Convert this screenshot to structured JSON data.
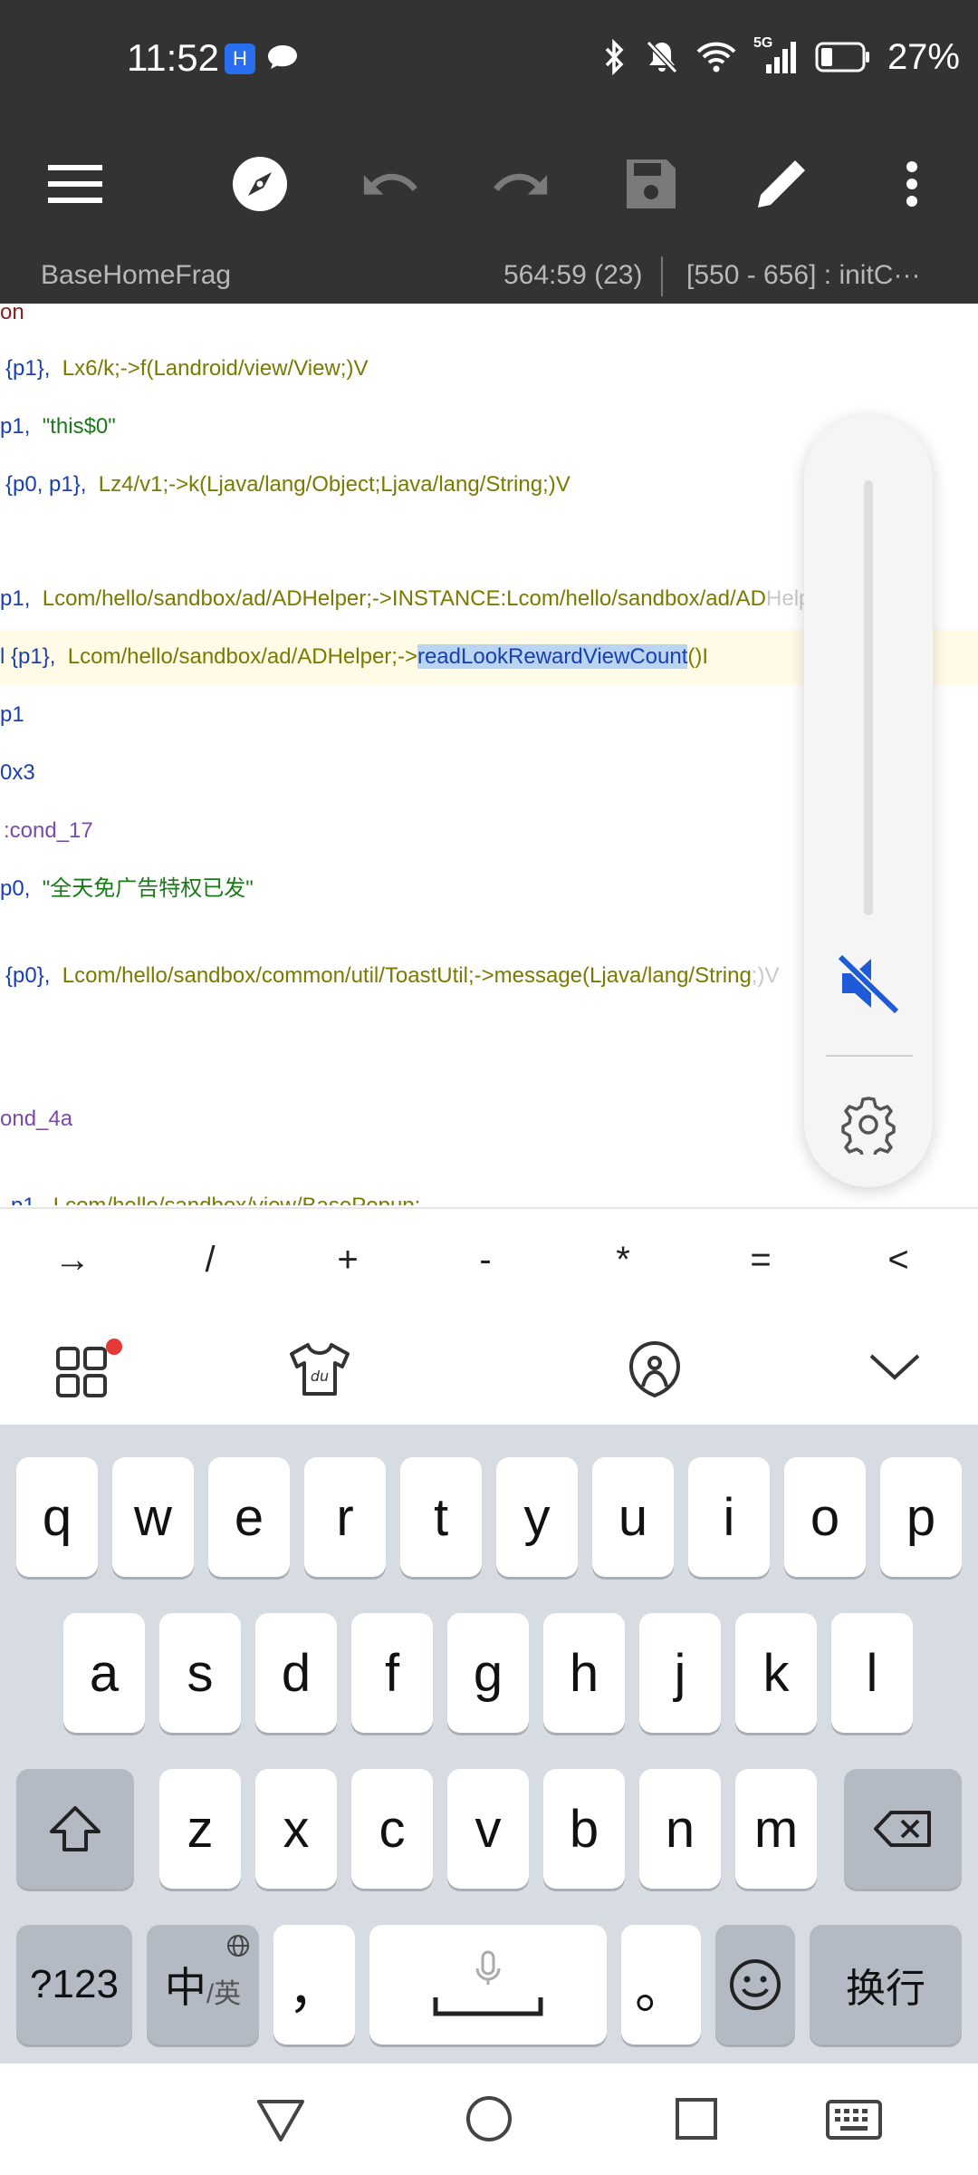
{
  "status": {
    "time": "11:52",
    "app_badge": "H",
    "network": "5G",
    "battery": "27%"
  },
  "editor": {
    "file_tab": "BaseHomeFrag",
    "cursor_pos": "564:59 (23)",
    "method_range": "[550 - 656] : initC···"
  },
  "code_lines": [
    {
      "c0": "on"
    },
    {
      "c0": "{p1},",
      "c1": "Lx6/k;->f(Landroid/view/View;)V"
    },
    {
      "c0": "p1,",
      "c1": "\"this$0\""
    },
    {
      "c0": "{p0, p1},",
      "c1": "Lz4/v1;->k(Ljava/lang/Object;Ljava/lang/String;)V"
    },
    {
      "c0": "p1,",
      "c1": "Lcom/hello/sandbox/ad/ADHelper;->INSTANCE:Lcom/hello/sandbox/ad/AD",
      "c2": "Helper;"
    },
    {
      "c0": "l {p1},",
      "c1": "Lcom/hello/sandbox/ad/ADHelper;->",
      "c2": "readLookRewardViewCount",
      "c3": "()I"
    },
    {
      "c0": "p1"
    },
    {
      "c0": "0x3"
    },
    {
      "c0": ":cond_17"
    },
    {
      "c0": "p0,",
      "c1": "\"全天免广告特权已发\""
    },
    {
      "c0": "{p0},",
      "c1": "Lcom/hello/sandbox/common/util/ToastUtil;->message(Ljava/lang/String",
      "c2": ";)V"
    },
    {
      "c0": "ond_4a"
    },
    {
      "c0": "p1,",
      "c1": "Lcom/hello/sandbox/view/BasePopup;"
    }
  ],
  "symbols": [
    "→",
    "/",
    "+",
    "-",
    "*",
    "=",
    "<"
  ],
  "keyboard": {
    "row1": [
      "q",
      "w",
      "e",
      "r",
      "t",
      "y",
      "u",
      "i",
      "o",
      "p"
    ],
    "row2": [
      "a",
      "s",
      "d",
      "f",
      "g",
      "h",
      "j",
      "k",
      "l"
    ],
    "row3": [
      "z",
      "x",
      "c",
      "v",
      "b",
      "n",
      "m"
    ],
    "num_key": "?123",
    "lang_key_main": "中",
    "lang_key_sub": "/英",
    "comma_key": "，",
    "period_key": "。",
    "enter_key": "换行"
  },
  "colors": {
    "toolbar_bg": "#333333",
    "selection": "#b9d5f2",
    "mute_accent": "#1f5bd8"
  }
}
